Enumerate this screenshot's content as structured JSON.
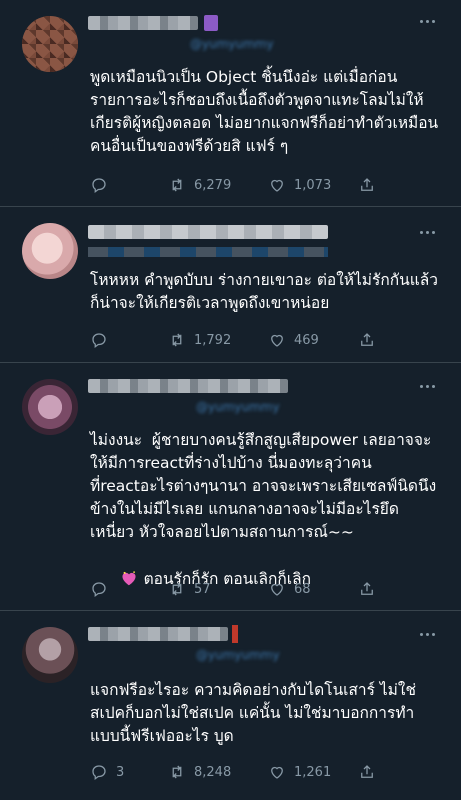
{
  "theme": {
    "background": "#15202b",
    "divider": "#38444d",
    "muted": "#8899a6",
    "text": "#ffffff",
    "handle": "#3b74a8"
  },
  "tweets": [
    {
      "handle_partial": "@yumyummy",
      "text": "พูดเหมือนนิวเป็น Object ชิ้นนึงอ่ะ แต่เมื่อก่อน รายการอะไรก็ชอบถึงเนื้อถึงตัวพูดจาแทะโลมไม่ให้เกียรติผู้หญิงตลอด ไม่อยากแจกฟรีก็อย่าทำตัวเหมือนคนอื่นเป็นของฟรีด้วยสิ แฟร์ ๆ",
      "reply_count": "",
      "retweet_count": "6,279",
      "like_count": "1,073",
      "avatar_icon": "blurred-avatar"
    },
    {
      "handle_partial": "",
      "text": "โหหหห คำพูดบับบ ร่างกายเขาอะ ต่อให้ไม่รักกันแล้วก็น่าจะให้เกียรติเวลาพูดถึงเขาหน่อย",
      "reply_count": "",
      "retweet_count": "1,792",
      "like_count": "469",
      "avatar_icon": "blurred-avatar"
    },
    {
      "handle_partial": "@yumyummy",
      "text": "ไม่งงนะ  ผู้ชายบางคนรู้สึกสูญเสียpower เลยอาจจะให้มีการreactที่ร่างไปบ้าง นี่มองทะลุว่าคนที่reactอะไรต่างๆนานา อาจจะเพราะเสียเซลฟ์นิดนึง ข้างในไม่มีไรเลย แกนกลางอาจจะไม่มีอะไรยึดเหนี่ยว หัวใจลอยไปตามสถานการณ์~~",
      "text_line2": "ตอนรักก็รัก ตอนเลิกก็เลิก",
      "reply_count": "",
      "retweet_count": "57",
      "like_count": "68",
      "avatar_icon": "blurred-avatar"
    },
    {
      "handle_partial": "@yumyummy",
      "text": "แจกฟรีอะไรอะ ความคิดอย่างกับไดโนเสาร์ ไม่ใช่สเปคก็บอกไม่ใช่สเปค แค่นั้น ไม่ใช่มาบอกการทำแบบนี้ฟรีเฟออะไร บูด",
      "reply_count": "3",
      "retweet_count": "8,248",
      "like_count": "1,261",
      "avatar_icon": "blurred-avatar"
    }
  ]
}
